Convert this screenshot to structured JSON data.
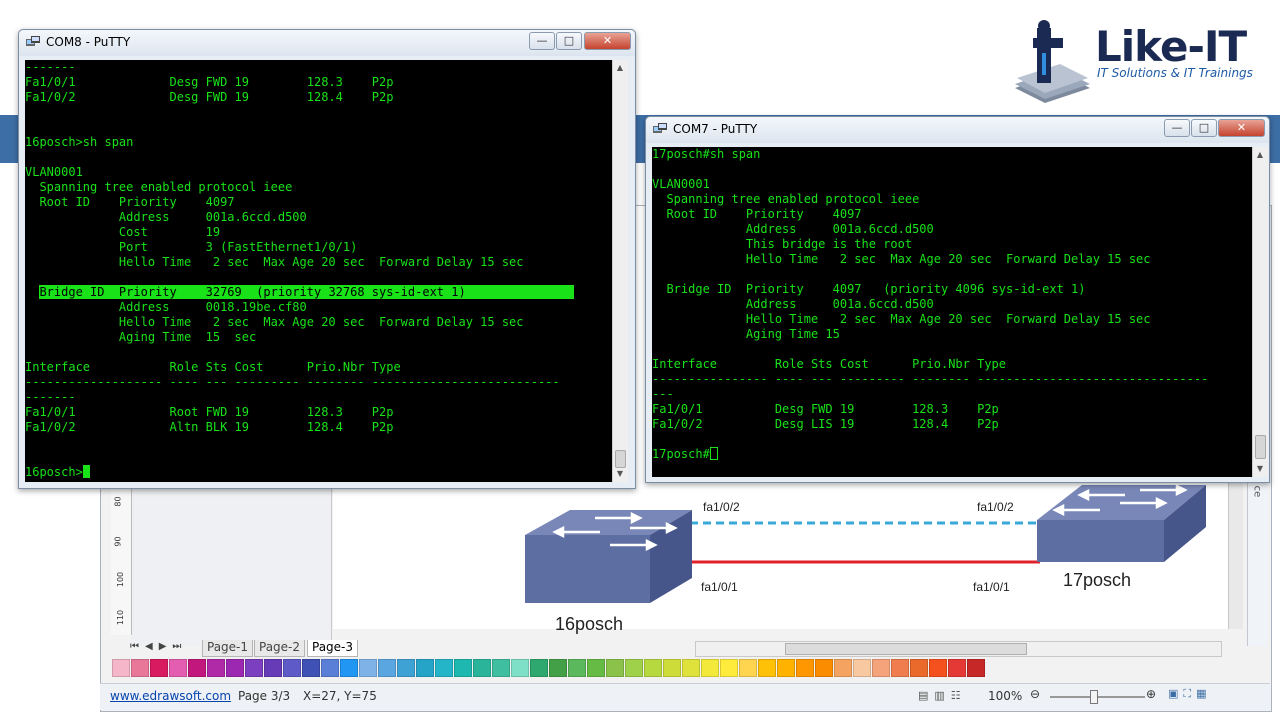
{
  "logo": {
    "name": "Like-IT",
    "tagline": "IT Solutions & IT Trainings"
  },
  "putty_left": {
    "title": "COM8 - PuTTY",
    "lines": [
      "-------",
      "Fa1/0/1             Desg FWD 19        128.3    P2p",
      "Fa1/0/2             Desg FWD 19        128.4    P2p",
      "",
      "",
      "16posch>sh span",
      "",
      "VLAN0001",
      "  Spanning tree enabled protocol ieee",
      "  Root ID    Priority    4097",
      "             Address     001a.6ccd.d500",
      "             Cost        19",
      "             Port        3 (FastEthernet1/0/1)",
      "             Hello Time   2 sec  Max Age 20 sec  Forward Delay 15 sec",
      "",
      "  Bridge ID  Priority    32769  (priority 32768 sys-id-ext 1)",
      "             Address     0018.19be.cf80",
      "             Hello Time   2 sec  Max Age 20 sec  Forward Delay 15 sec",
      "             Aging Time  15  sec",
      "",
      "Interface           Role Sts Cost      Prio.Nbr Type",
      "------------------- ---- --- --------- -------- --------------------------",
      "-------",
      "Fa1/0/1             Root FWD 19        128.3    P2p",
      "Fa1/0/2             Altn BLK 19        128.4    P2p",
      "",
      "",
      "16posch>"
    ]
  },
  "putty_right": {
    "title": "COM7 - PuTTY",
    "lines": [
      "17posch#sh span",
      "",
      "VLAN0001",
      "  Spanning tree enabled protocol ieee",
      "  Root ID    Priority    4097",
      "             Address     001a.6ccd.d500",
      "             This bridge is the root",
      "             Hello Time   2 sec  Max Age 20 sec  Forward Delay 15 sec",
      "",
      "  Bridge ID  Priority    4097   (priority 4096 sys-id-ext 1)",
      "             Address     001a.6ccd.d500",
      "             Hello Time   2 sec  Max Age 20 sec  Forward Delay 15 sec",
      "             Aging Time 15",
      "",
      "Interface        Role Sts Cost      Prio.Nbr Type",
      "---------------- ---- --- --------- -------- --------------------------------",
      "---",
      "Fa1/0/1          Desg FWD 19        128.3    P2p",
      "Fa1/0/2          Desg LIS 19        128.4    P2p",
      "",
      "17posch#"
    ]
  },
  "diagram": {
    "switch_left": "16posch",
    "switch_right": "17posch",
    "top_left_port": "fa1/0/2",
    "top_right_port": "fa1/0/2",
    "bottom_left_port": "fa1/0/1",
    "bottom_right_port": "fa1/0/1",
    "top_link_color": "#3aa9d9",
    "bottom_link_color": "#e0202a",
    "switch_color": "#5d6ea3"
  },
  "edraw": {
    "ruler_marks": [
      "80",
      "90",
      "100",
      "110"
    ],
    "page_tabs": [
      "Page-1",
      "Page-2",
      "Page-3"
    ],
    "side_tab_text": "ce",
    "status": {
      "website": "www.edrawsoft.com",
      "page": "Page 3/3",
      "coords": "X=27, Y=75",
      "zoom": "100%"
    },
    "palette": [
      "#f4b6c8",
      "#e9779a",
      "#d81b60",
      "#e35db0",
      "#c2187d",
      "#b02aa8",
      "#9c27b0",
      "#7b3fbf",
      "#673ab7",
      "#5e5ac8",
      "#3f51b5",
      "#5a7fd6",
      "#2196f3",
      "#7fb3e8",
      "#5aa6e0",
      "#3fa2d4",
      "#26a4c8",
      "#25b5c9",
      "#1fb8b0",
      "#2ab59a",
      "#3fbfa0",
      "#7fe0c8",
      "#2ea86f",
      "#43a047",
      "#5cb85c",
      "#66bb44",
      "#8bc34a",
      "#9fd14a",
      "#b5d93e",
      "#cddc39",
      "#dfe23b",
      "#f2e93a",
      "#ffeb3b",
      "#ffd54f",
      "#ffc107",
      "#ffb300",
      "#ff9800",
      "#fb8c00",
      "#f4a460",
      "#f8c8a0",
      "#f5a37a",
      "#ef7d4d",
      "#e96a2b",
      "#f4511e",
      "#e53935",
      "#c62828"
    ]
  }
}
